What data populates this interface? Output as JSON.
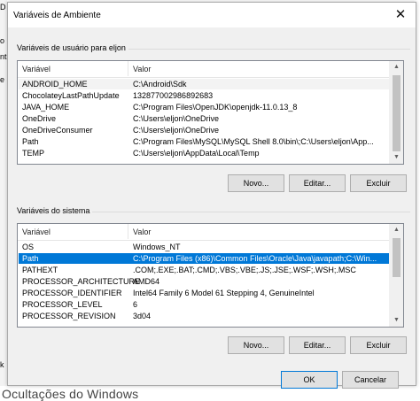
{
  "background": {
    "fragments": [
      "D",
      "o",
      "nt",
      "e",
      "k"
    ],
    "bottom_text": "Ocultações do Windows"
  },
  "dialog": {
    "title": "Variáveis de Ambiente",
    "close_glyph": "✕",
    "user_group": {
      "label": "Variáveis de usuário para eljon",
      "columns": [
        "Variável",
        "Valor"
      ],
      "rows": [
        {
          "name": "ANDROID_HOME",
          "value": "C:\\Android\\Sdk"
        },
        {
          "name": "ChocolateyLastPathUpdate",
          "value": "132877002986892683"
        },
        {
          "name": "JAVA_HOME",
          "value": "C:\\Program Files\\OpenJDK\\openjdk-11.0.13_8"
        },
        {
          "name": "OneDrive",
          "value": "C:\\Users\\eljon\\OneDrive"
        },
        {
          "name": "OneDriveConsumer",
          "value": "C:\\Users\\eljon\\OneDrive"
        },
        {
          "name": "Path",
          "value": "C:\\Program Files\\MySQL\\MySQL Shell 8.0\\bin\\;C:\\Users\\eljon\\App..."
        },
        {
          "name": "TEMP",
          "value": "C:\\Users\\eljon\\AppData\\Local\\Temp"
        }
      ],
      "buttons": {
        "new": "Novo...",
        "edit": "Editar...",
        "delete": "Excluir"
      }
    },
    "system_group": {
      "label": "Variáveis do sistema",
      "columns": [
        "Variável",
        "Valor"
      ],
      "rows": [
        {
          "name": "OS",
          "value": "Windows_NT"
        },
        {
          "name": "Path",
          "value": "C:\\Program Files (x86)\\Common Files\\Oracle\\Java\\javapath;C:\\Win..."
        },
        {
          "name": "PATHEXT",
          "value": ".COM;.EXE;.BAT;.CMD;.VBS;.VBE;.JS;.JSE;.WSF;.WSH;.MSC"
        },
        {
          "name": "PROCESSOR_ARCHITECTURE",
          "value": "AMD64"
        },
        {
          "name": "PROCESSOR_IDENTIFIER",
          "value": "Intel64 Family 6 Model 61 Stepping 4, GenuineIntel"
        },
        {
          "name": "PROCESSOR_LEVEL",
          "value": "6"
        },
        {
          "name": "PROCESSOR_REVISION",
          "value": "3d04"
        }
      ],
      "selected_index": 1,
      "buttons": {
        "new": "Novo...",
        "edit": "Editar...",
        "delete": "Excluir"
      }
    },
    "footer": {
      "ok": "OK",
      "cancel": "Cancelar"
    },
    "colors": {
      "selection": "#0078d7",
      "default_button_border": "#0078d7"
    }
  }
}
